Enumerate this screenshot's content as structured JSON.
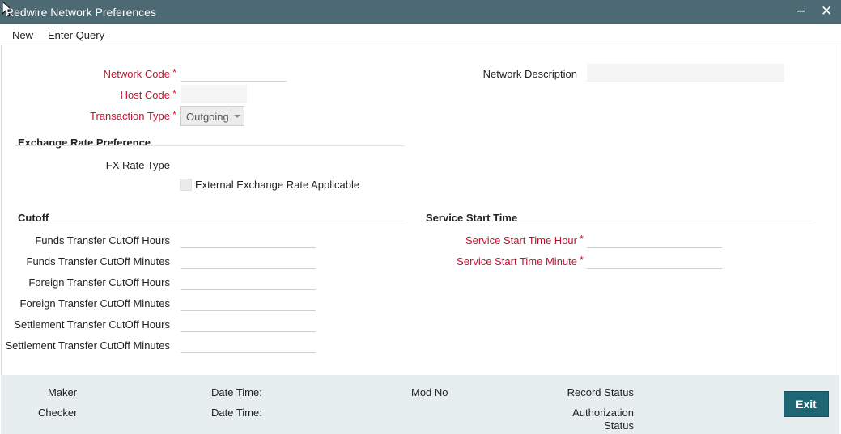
{
  "window": {
    "title": "Redwire Network Preferences",
    "minimize_glyph": "‒",
    "close_glyph": "✕"
  },
  "menu": {
    "new_label": "New",
    "enter_query_label": "Enter Query"
  },
  "form": {
    "network_code": {
      "label": "Network Code",
      "value": ""
    },
    "host_code": {
      "label": "Host Code",
      "value": ""
    },
    "transaction_type": {
      "label": "Transaction Type",
      "value": "Outgoing"
    },
    "network_description": {
      "label": "Network Description",
      "value": ""
    },
    "required_marker": "*"
  },
  "exchange_rate": {
    "heading": "Exchange Rate Preference",
    "fx_rate_type_label": "FX Rate Type",
    "external_rate_label": "External Exchange Rate Applicable",
    "external_rate_checked": false
  },
  "cutoff": {
    "heading": "Cutoff",
    "fields": [
      {
        "label": "Funds Transfer CutOff Hours",
        "value": ""
      },
      {
        "label": "Funds Transfer CutOff Minutes",
        "value": ""
      },
      {
        "label": "Foreign Transfer CutOff Hours",
        "value": ""
      },
      {
        "label": "Foreign Transfer CutOff Minutes",
        "value": ""
      },
      {
        "label": "Settlement Transfer CutOff Hours",
        "value": ""
      },
      {
        "label": "Settlement Transfer CutOff Minutes",
        "value": ""
      }
    ]
  },
  "service_start": {
    "heading": "Service Start Time",
    "hour_label": "Service Start Time Hour",
    "minute_label": "Service Start Time Minute"
  },
  "footer": {
    "maker_label": "Maker",
    "checker_label": "Checker",
    "date_time_label": "Date Time:",
    "mod_no_label": "Mod No",
    "record_status_label": "Record Status",
    "authorization_label": "Authorization",
    "status_label": "Status",
    "exit_label": "Exit"
  },
  "colors": {
    "titlebar": "#4d6a74",
    "required": "#c8102e",
    "footer_bg": "#e7eef0",
    "exit_button": "#1f6674"
  }
}
